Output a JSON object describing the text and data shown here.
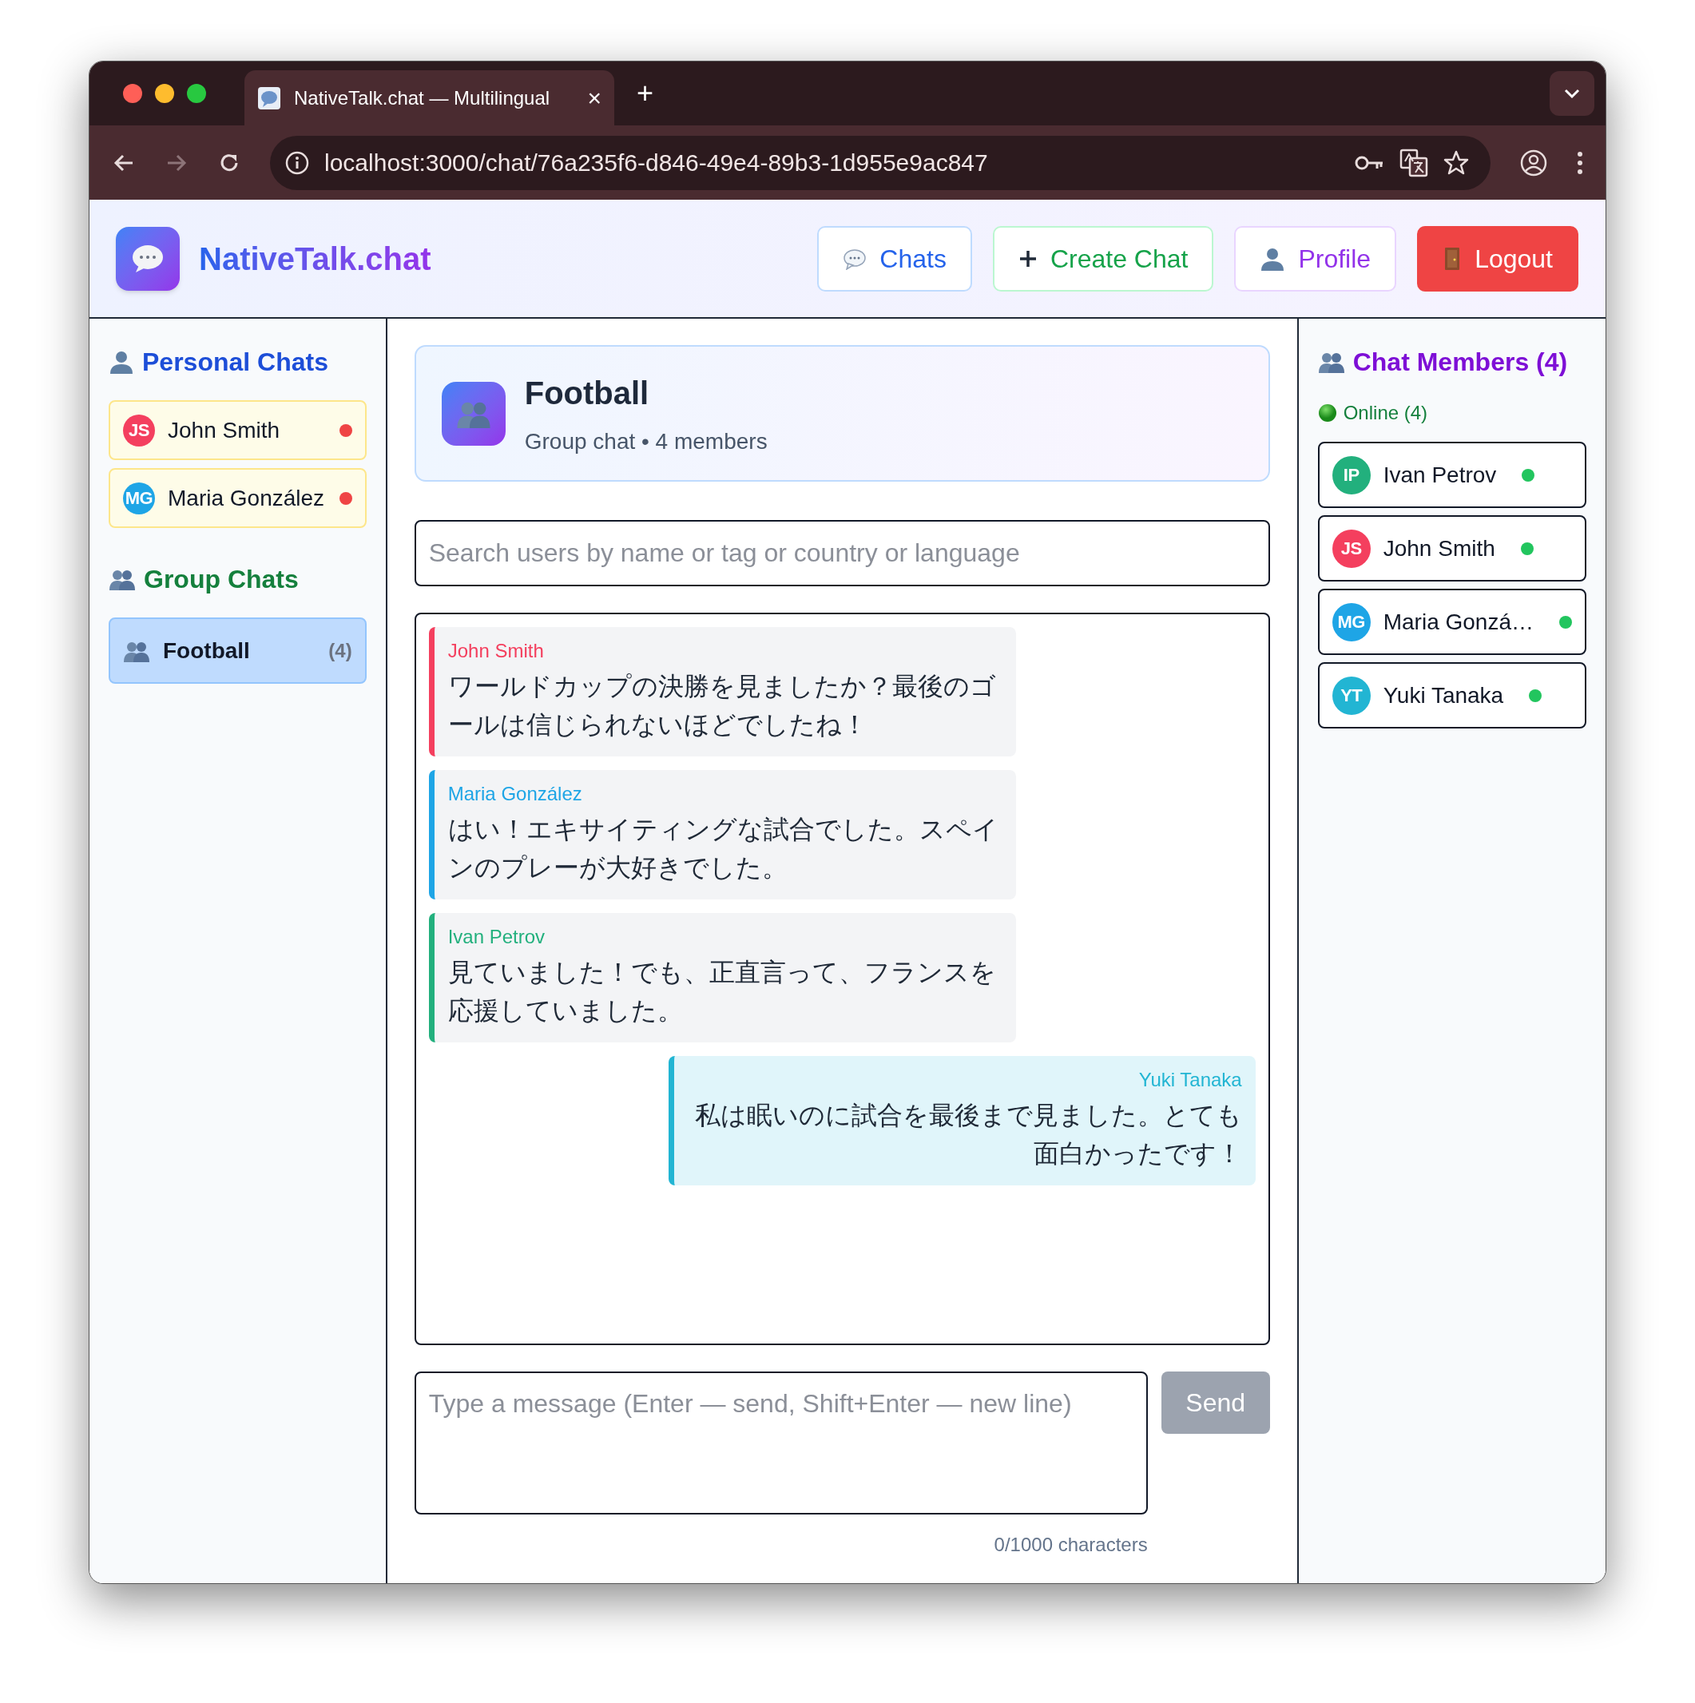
{
  "browser": {
    "tab_title": "NativeTalk.chat — Multilingual",
    "tab_close": "×",
    "new_tab": "+",
    "url": "localhost:3000/chat/76a235f6-d846-49e4-89b3-1d955e9ac847"
  },
  "header": {
    "brand": "NativeTalk.chat",
    "nav": [
      {
        "label": "Chats",
        "kind": "chats"
      },
      {
        "label": "Create Chat",
        "kind": "create"
      },
      {
        "label": "Profile",
        "kind": "profile"
      },
      {
        "label": "Logout",
        "kind": "logout"
      }
    ]
  },
  "sidebar": {
    "personal_title": "Personal Chats",
    "personal": [
      {
        "initials": "JS",
        "name": "John Smith",
        "color": "#f43f5e",
        "unread": true
      },
      {
        "initials": "MG",
        "name": "Maria González",
        "color": "#1ea5e6",
        "unread": true
      }
    ],
    "group_title": "Group Chats",
    "groups": [
      {
        "name": "Football",
        "count": "(4)",
        "selected": true
      }
    ]
  },
  "chat": {
    "title": "Football",
    "subtitle": "Group chat • 4 members",
    "search_placeholder": "Search users by name or tag or country or language",
    "messages": [
      {
        "sender": "John Smith",
        "text": "ワールドカップの決勝を見ましたか？最後のゴールは信じられないほどでしたね！",
        "color": "#f43f5e",
        "own": false
      },
      {
        "sender": "Maria González",
        "text": "はい！エキサイティングな試合でした。スペインのプレーが大好きでした。",
        "color": "#1ea5e6",
        "own": false
      },
      {
        "sender": "Ivan Petrov",
        "text": "見ていました！でも、正直言って、フランスを応援していました。",
        "color": "#22b07d",
        "own": false
      },
      {
        "sender": "Yuki Tanaka",
        "text": "私は眠いのに試合を最後まで見ました。とても面白かったです！",
        "color": "#22b5d3",
        "own": true
      }
    ],
    "composer": {
      "placeholder": "Type a message (Enter — send, Shift+Enter — new line)",
      "send": "Send",
      "send_disabled": true,
      "counter": "0/1000 characters"
    }
  },
  "members": {
    "title": "Chat Members (4)",
    "online_label": "Online (4)",
    "list": [
      {
        "initials": "IP",
        "name": "Ivan Petrov",
        "color": "#22b07d",
        "online": true
      },
      {
        "initials": "JS",
        "name": "John Smith",
        "color": "#f43f5e",
        "online": true
      },
      {
        "initials": "MG",
        "name": "Maria Gonzá…",
        "color": "#1ea5e6",
        "online": true
      },
      {
        "initials": "YT",
        "name": "Yuki Tanaka",
        "color": "#22b5d3",
        "online": true
      }
    ]
  }
}
